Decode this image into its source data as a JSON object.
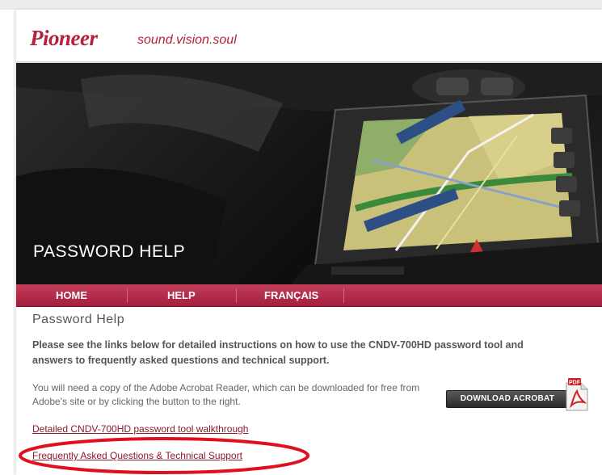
{
  "header": {
    "brand": "Pioneer",
    "tagline": "sound.vision.soul",
    "brand_color": "#b5203c"
  },
  "hero": {
    "title": "PASSWORD HELP"
  },
  "nav": {
    "items": [
      {
        "label": "HOME"
      },
      {
        "label": "HELP"
      },
      {
        "label": "FRANÇAIS"
      }
    ],
    "color": "#b32a49"
  },
  "content": {
    "title": "Password Help",
    "intro": "Please see the links below for detailed instructions on how to use the CNDV-700HD password tool and answers to frequently asked questions and technical support.",
    "acrobat_note": "You will need a copy of the Adobe Acrobat Reader, which can be downloaded for free from Adobe's site or by clicking the button to the right.",
    "download_button": "DOWNLOAD ACROBAT",
    "pdf_icon_label": "PDF",
    "links": {
      "walkthrough": "Detailed CNDV-700HD password tool walkthrough",
      "faq": "Frequently Asked Questions & Technical Support"
    },
    "highlight_color": "#e0101f"
  }
}
